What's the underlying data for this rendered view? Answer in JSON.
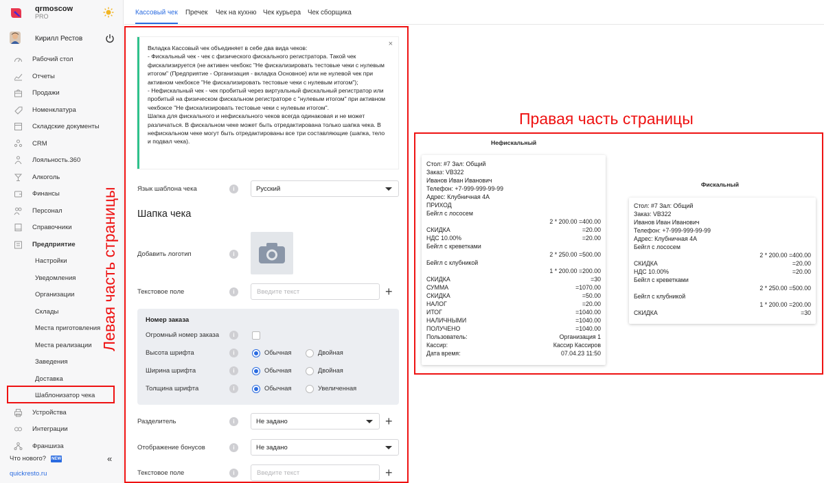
{
  "app": {
    "name": "qrmoscow",
    "plan": "PRO"
  },
  "user": {
    "name": "Кирилл Рестов"
  },
  "sidebar": {
    "items": [
      {
        "label": "Рабочий стол",
        "icon": "dashboard-icon"
      },
      {
        "label": "Отчеты",
        "icon": "chart-icon"
      },
      {
        "label": "Продажи",
        "icon": "cart-icon"
      },
      {
        "label": "Номенклатура",
        "icon": "tag-icon"
      },
      {
        "label": "Складские документы",
        "icon": "box-icon"
      },
      {
        "label": "CRM",
        "icon": "people-icon"
      },
      {
        "label": "Лояльность.360",
        "icon": "loyalty-icon"
      },
      {
        "label": "Алкоголь",
        "icon": "glass-icon"
      },
      {
        "label": "Финансы",
        "icon": "wallet-icon"
      },
      {
        "label": "Персонал",
        "icon": "staff-icon"
      },
      {
        "label": "Справочники",
        "icon": "book-icon"
      },
      {
        "label": "Предприятие",
        "icon": "building-icon"
      }
    ],
    "sub_items": [
      "Настройки",
      "Уведомления",
      "Организации",
      "Склады",
      "Места приготовления",
      "Места реализации",
      "Заведения",
      "Доставка",
      "Шаблонизатор чека"
    ],
    "items_after": [
      {
        "label": "Устройства",
        "icon": "printer-icon"
      },
      {
        "label": "Интеграции",
        "icon": "link-icon"
      },
      {
        "label": "Франшиза",
        "icon": "franchise-icon"
      }
    ],
    "whats_new": "Что нового?",
    "new_badge": "NEW",
    "site": "quickresto.ru"
  },
  "tabs": [
    "Кассовый чек",
    "Пречек",
    "Чек на кухню",
    "Чек курьера",
    "Чек сборщика"
  ],
  "annotations": {
    "left": "Левая часть страницы",
    "right": "Правая часть страницы"
  },
  "info": {
    "text": " Вкладка Кассовый чек объединяет в себе два вида чеков:\n- Фискальный чек - чек с физического фискального регистратора. Такой чек фискализируется (не активен чекбокс \"Не фискализировать тестовые чеки с нулевым итогом\" (Предприятие - Организация - вкладка Основное) или не нулевой чек при активном чекбоксе \"Не фискализировать тестовые чеки с нулевым итогом\");\n- Нефискальный чек - чек пробитый через виртуальный фискальный регистратор или пробитый на физическом фискальном регистраторе с \"нулевым итогом\" при активном чекбоксе \"Не фискализировать тестовые чеки с нулевым итогом\".\nШапка для фискального и нефискального чеков всегда одинаковая и не может различаться. В фискальном чеке может быть отредактирована только шапка чека. В нефискальном чеке могут быть отредактированы все три составляющие (шапка, тело и подвал чека).",
    "close": "×"
  },
  "form": {
    "language_label": "Язык шаблона чека",
    "language_value": "Русский",
    "header_title": "Шапка чека",
    "logo_label": "Добавить логотип",
    "text_field_label": "Текстовое поле",
    "text_placeholder": "Введите текст",
    "order_title": "Номер заказа",
    "huge_order_label": "Огромный номер заказа",
    "font_height_label": "Высота шрифта",
    "font_width_label": "Ширина шрифта",
    "font_weight_label": "Толщина шрифта",
    "opt_normal": "Обычная",
    "opt_double": "Двойная",
    "opt_bold": "Увеличенная",
    "separator_label": "Разделитель",
    "separator_value": "Не задано",
    "bonus_label": "Отображение бонусов",
    "bonus_value": "Не задано",
    "text_field2_label": "Текстовое поле"
  },
  "receipt_nonfiscal": {
    "caption": "Нефискальный",
    "lines": [
      {
        "l": "Стол: #7 Зал: Общий"
      },
      {
        "l": "Заказ: VB322"
      },
      {
        "l": "Иванов Иван Иванович"
      },
      {
        "l": "Телефон: +7-999-999-99-99"
      },
      {
        "l": "Адрес: Клубничная 4А"
      },
      {
        "l": "ПРИХОД"
      },
      {
        "l": "Бейгл с лососем"
      },
      {
        "r": "2 * 200.00 =400.00"
      },
      {
        "l": "СКИДКА",
        "r": "=20.00"
      },
      {
        "l": "НДС 10.00%",
        "r": "=20.00"
      },
      {
        "l": "Бейгл с креветками"
      },
      {
        "r": "2 * 250.00 =500.00"
      },
      {
        "l": "Бейгл с клубникой"
      },
      {
        "r": "1 * 200.00 =200.00"
      },
      {
        "l": "СКИДКА",
        "r": "=30"
      },
      {
        "l": "СУММА",
        "r": "=1070.00"
      },
      {
        "l": "СКИДКА",
        "r": "=50.00"
      },
      {
        "l": "НАЛОГ",
        "r": "=20.00"
      },
      {
        "l": "ИТОГ",
        "r": "=1040.00"
      },
      {
        "l": "НАЛИЧНЫМИ",
        "r": "=1040.00"
      },
      {
        "l": "ПОЛУЧЕНО",
        "r": "=1040.00"
      },
      {
        "l": "Пользователь:",
        "r": "Организация 1"
      },
      {
        "l": "Кассир:",
        "r": "Кассир Кассиров"
      },
      {
        "l": "Дата время:",
        "r": "07.04.23 11:50"
      }
    ]
  },
  "receipt_fiscal": {
    "caption": "Фискальный",
    "lines": [
      {
        "l": "Стол: #7 Зал: Общий"
      },
      {
        "l": "Заказ: VB322"
      },
      {
        "l": "Иванов Иван Иванович"
      },
      {
        "l": "Телефон: +7-999-999-99-99"
      },
      {
        "l": "Адрес: Клубничная 4А"
      },
      {
        "l": "Бейгл с лососем"
      },
      {
        "r": "2 * 200.00 =400.00"
      },
      {
        "l": "СКИДКА",
        "r": "=20.00"
      },
      {
        "l": "НДС 10.00%",
        "r": "=20.00"
      },
      {
        "l": "Бейгл с креветками"
      },
      {
        "r": "2 * 250.00 =500.00"
      },
      {
        "l": "Бейгл с клубникой"
      },
      {
        "r": "1 * 200.00 =200.00"
      },
      {
        "l": "СКИДКА",
        "r": "=30"
      }
    ]
  },
  "colors": {
    "accent": "#2a6be0",
    "annotation": "#e11111",
    "info_border": "#2ec28c"
  }
}
